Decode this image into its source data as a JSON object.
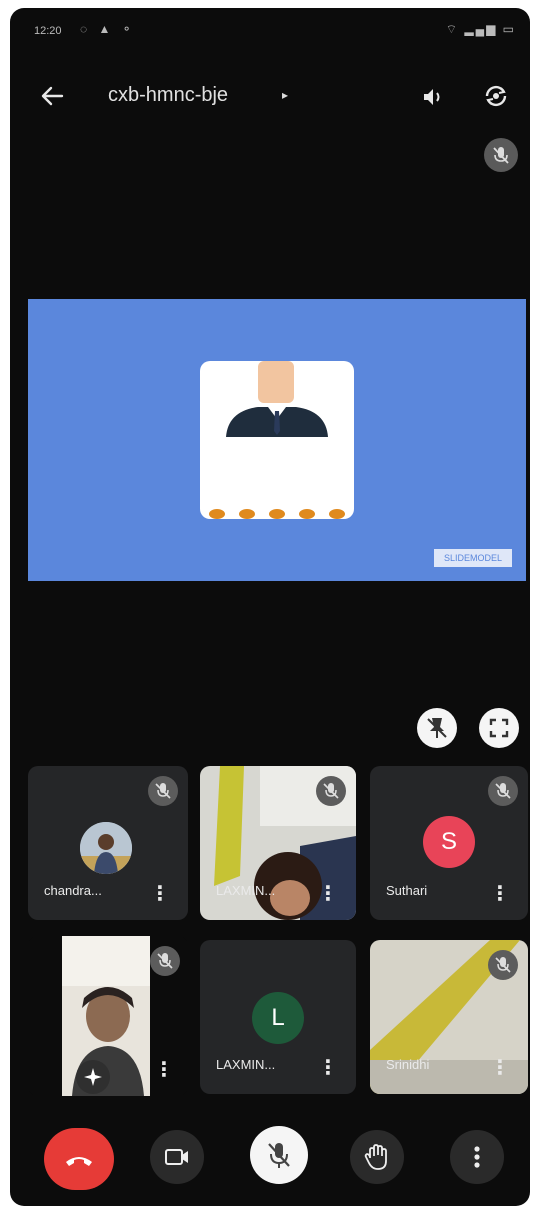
{
  "status_bar": {
    "time": "12:20"
  },
  "header": {
    "meeting_code": "cxb-hmnc-bje"
  },
  "presentation": {
    "watermark_text": "SLIDEMODEL"
  },
  "participants": [
    {
      "name": "chandra...",
      "kind": "photo"
    },
    {
      "name": "LAXMIN...",
      "kind": "video"
    },
    {
      "name": "Suthari",
      "initial": "S",
      "avatar_color": "#e84458"
    },
    {
      "name": "",
      "kind": "self-video"
    },
    {
      "name": "LAXMIN...",
      "initial": "L",
      "avatar_color": "#1e5a3a"
    },
    {
      "name": "Srinidhi",
      "kind": "video"
    }
  ],
  "icons": {
    "back": "arrow-left-icon",
    "speaker": "speaker-icon",
    "flip": "camera-flip-icon",
    "mute": "mic-off-icon",
    "pin": "unpin-icon",
    "fullscreen": "fullscreen-icon",
    "hangup": "hangup-icon",
    "camera": "video-camera-icon",
    "hand": "raise-hand-icon",
    "more": "more-vert-icon",
    "effects": "sparkle-effects-icon"
  },
  "colors": {
    "background": "#0c0c0c",
    "tile": "#252628",
    "presentation": "#5b87dc",
    "hangup": "#e63b37",
    "mute_badge": "#5c5c5c"
  }
}
